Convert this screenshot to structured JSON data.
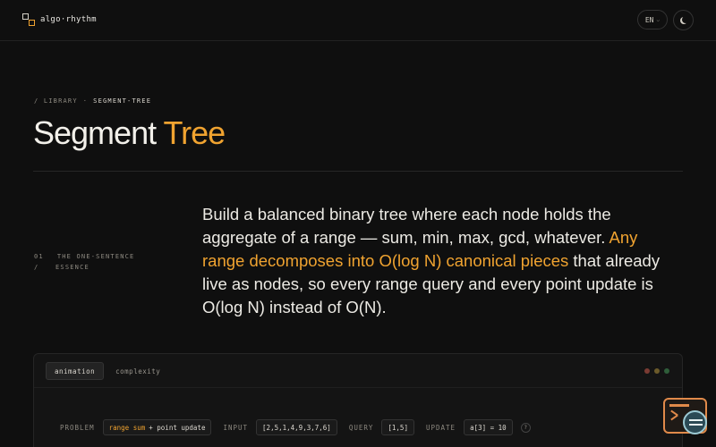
{
  "header": {
    "logo_text": "algo·rhythm",
    "language": "EN",
    "icons": {
      "logo": "logo-mark-icon",
      "language_caret": "chevron-down-icon",
      "theme": "moon-icon"
    }
  },
  "breadcrumb": {
    "root": "/ LIBRARY",
    "separator": "·",
    "current": "SEGMENT-TREE"
  },
  "title": {
    "main": "Segment",
    "accent": "Tree"
  },
  "essence": {
    "number": "01",
    "slash": "/",
    "label_line1": "THE ONE-SENTENCE",
    "label_line2": "ESSENCE",
    "text_before": "Build a balanced binary tree where each node holds the aggregate of a range — sum, min, max, gcd, whatever. ",
    "text_highlight": "Any range decomposes into O(log N) canonical pieces",
    "text_after": " that already live as nodes, so every range query and every point update is O(log N) instead of O(N)."
  },
  "panel": {
    "tabs": [
      "animation",
      "complexity"
    ],
    "active_tab": "animation",
    "window_dots": [
      "#7a3b33",
      "#6b5a2a",
      "#2f5e3a"
    ],
    "controls": {
      "problem_label": "PROBLEM",
      "problem_value_highlight": "range sum",
      "problem_value_rest": "+ point update",
      "input_label": "INPUT",
      "input_value": "[2,5,1,4,9,3,7,6]",
      "query_label": "QUERY",
      "query_value": "[1,5]",
      "update_label": "UPDATE",
      "update_value": "a[3] = 10",
      "help": "?"
    }
  },
  "colors": {
    "accent": "#f0a330",
    "background": "#0f0f0f",
    "text": "#e8e6e1"
  },
  "assistant_icon": "terminal-chat-icon"
}
